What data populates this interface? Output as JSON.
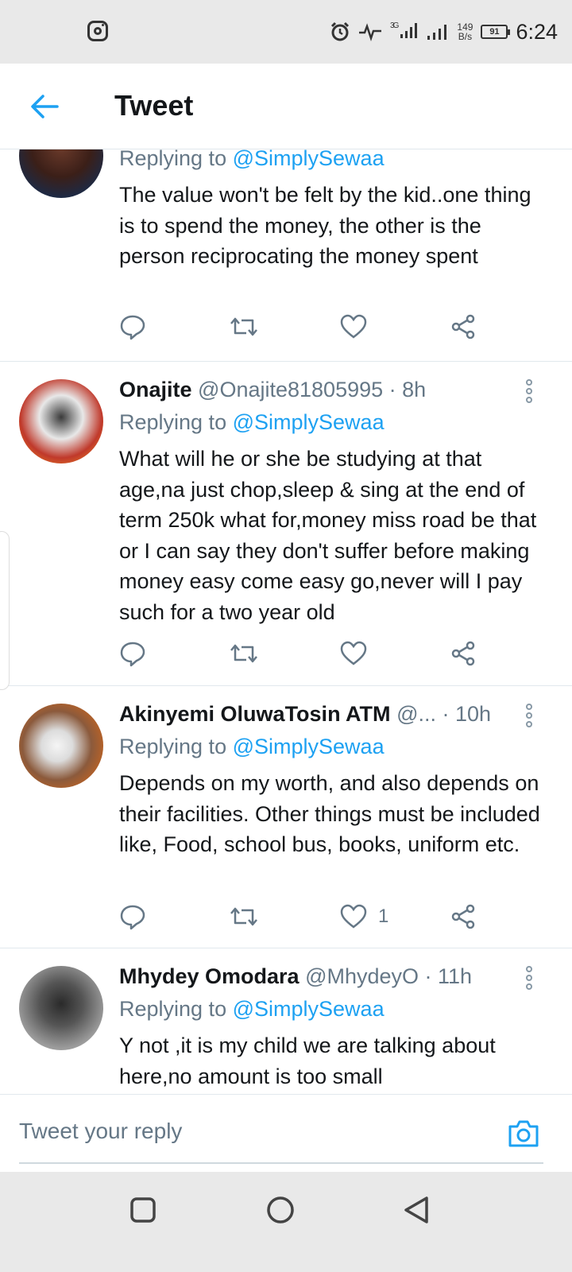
{
  "status_bar": {
    "time": "6:24",
    "battery": "91",
    "network": "3G",
    "speed_value": "149",
    "speed_unit": "B/s"
  },
  "header": {
    "title": "Tweet"
  },
  "tweets": [
    {
      "name": "",
      "handle": "",
      "time": "",
      "replying_prefix": "Replying to",
      "replying_to": "@SimplySewaa",
      "text": "The value won't be felt by the kid..one thing is to spend the money, the other is the person reciprocating the money spent",
      "likes": ""
    },
    {
      "name": "Onajite",
      "handle": "@Onajite81805995",
      "time": "8h",
      "replying_prefix": "Replying to",
      "replying_to": "@SimplySewaa",
      "text": "What will he or she be studying at that age,na just chop,sleep & sing at the end of term 250k what for,money miss road be that or I can say they don't suffer before making money easy come easy go,never will I pay such for a two year old",
      "likes": ""
    },
    {
      "name": "Akinyemi OluwaTosin ATM",
      "handle": "@...",
      "time": "10h",
      "replying_prefix": "Replying to",
      "replying_to": "@SimplySewaa",
      "text": "Depends on my worth, and also depends on their facilities. Other things must be included like, Food, school bus, books, uniform etc.",
      "likes": "1"
    },
    {
      "name": "Mhydey Omodara",
      "handle": "@MhydeyO",
      "time": "11h",
      "replying_prefix": "Replying to",
      "replying_to": "@SimplySewaa",
      "text": "Y not ,it is my child we are talking about here,no amount is too small",
      "likes": ""
    }
  ],
  "reply_bar": {
    "placeholder": "Tweet your reply"
  },
  "colors": {
    "accent": "#1da1f2",
    "secondary_text": "#657786",
    "divider": "#e1e8ed"
  }
}
